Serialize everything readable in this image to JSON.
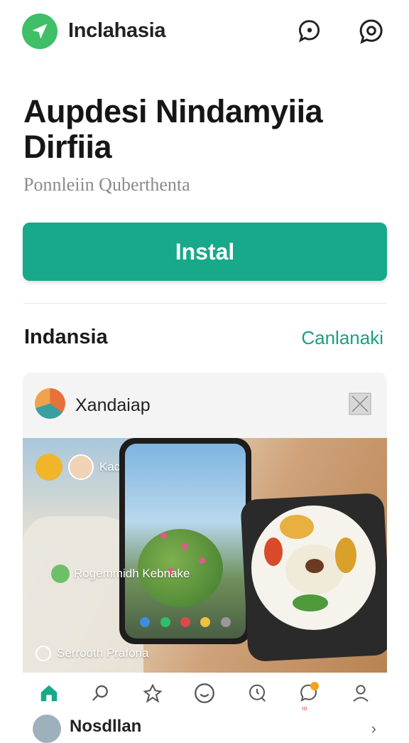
{
  "header": {
    "app_name": "Inclahasia",
    "icons": [
      "navigation-arrow-icon",
      "chat-bubble-icon",
      "search-icon"
    ]
  },
  "hero": {
    "headline": "Aupdesi Nindamyiia Dirfiia",
    "subtitle": "Ponnleiin Quberthenta",
    "install_label": "Instal"
  },
  "section": {
    "title": "Indansia",
    "link": "Canlanaki"
  },
  "card": {
    "title": "Xandaiap",
    "overlay": {
      "user_label": "Kact",
      "location_label": "Rogemmidh Kebnake",
      "footer_label": "Serrooth Prafona"
    }
  },
  "bottom_nav": {
    "items": [
      "home-icon",
      "search-icon",
      "profile-alt-icon",
      "chat-icon",
      "clock-search-icon",
      "notifications-icon",
      "user-icon"
    ],
    "badge_label": "ıo"
  },
  "peek": {
    "text": "Nosdllan"
  },
  "colors": {
    "accent": "#17a98a",
    "logo": "#3fbf67",
    "link": "#1a9e86",
    "badge": "#f2a21b"
  }
}
